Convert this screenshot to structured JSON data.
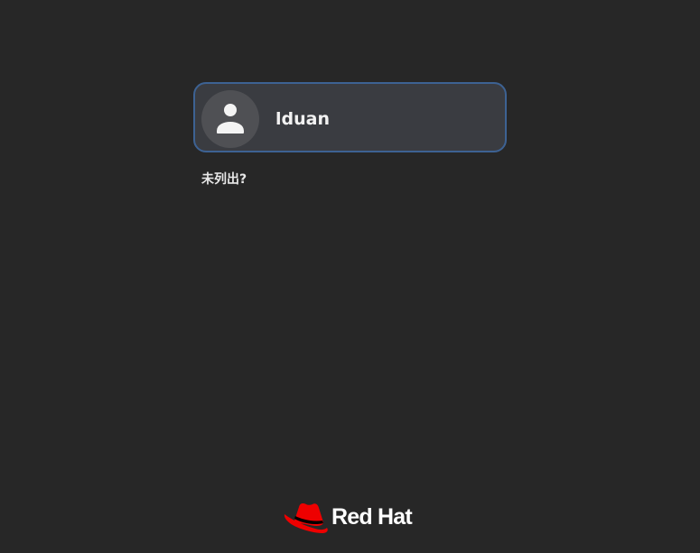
{
  "login": {
    "users": [
      {
        "name": "lduan",
        "avatar_icon": "user-avatar-icon"
      }
    ],
    "not_listed_label": "未列出?"
  },
  "branding": {
    "logo_icon": "redhat-fedora-icon",
    "logo_text": "Red Hat"
  },
  "colors": {
    "background": "#272727",
    "card_background": "#3a3c41",
    "card_border_focus": "#3d6293",
    "avatar_background": "#4f5054",
    "brand_red": "#ee0000"
  }
}
